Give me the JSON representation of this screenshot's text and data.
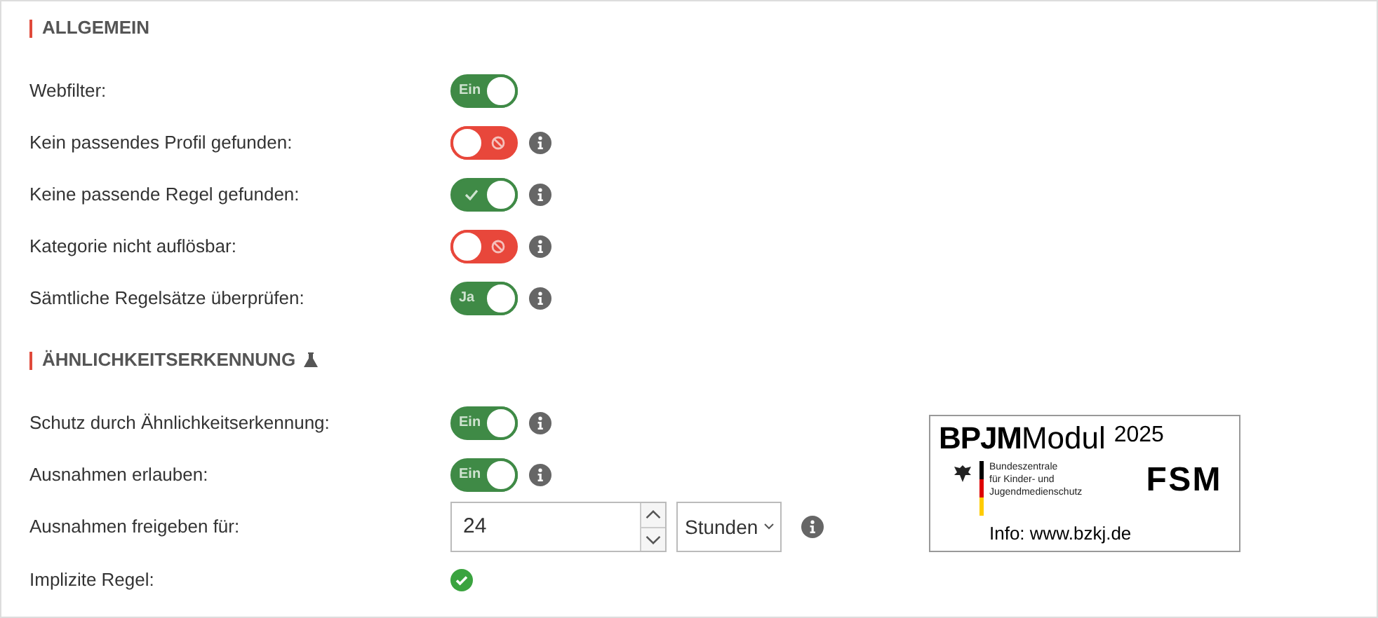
{
  "sections": [
    {
      "title": "ALLGEMEIN",
      "flask": false,
      "rows": [
        {
          "kind": "toggle",
          "label": "Webfilter:",
          "on": true,
          "text": "Ein",
          "info": false
        },
        {
          "kind": "toggle",
          "label": "Kein passendes Profil gefunden:",
          "on": false,
          "info": true
        },
        {
          "kind": "toggle",
          "label": "Keine passende Regel gefunden:",
          "on": true,
          "info": true
        },
        {
          "kind": "toggle",
          "label": "Kategorie nicht auflösbar:",
          "on": false,
          "info": true
        },
        {
          "kind": "toggle",
          "label": "Sämtliche Regelsätze überprüfen:",
          "on": true,
          "text": "Ja",
          "info": true
        }
      ]
    },
    {
      "title": "ÄHNLICHKEITSERKENNUNG",
      "flask": true,
      "rows": [
        {
          "kind": "toggle",
          "label": "Schutz durch Ähnlichkeitserkennung:",
          "on": true,
          "text": "Ein",
          "info": true
        },
        {
          "kind": "toggle",
          "label": "Ausnahmen erlauben:",
          "on": true,
          "text": "Ein",
          "info": true
        },
        {
          "kind": "number",
          "label": "Ausnahmen freigeben für:",
          "value": "24",
          "unit": "Stunden",
          "info": true
        },
        {
          "kind": "check",
          "label": "Implizite Regel:",
          "checked": true
        }
      ]
    }
  ],
  "logo": {
    "brand_bold": "BPJM",
    "brand_light": "Modul",
    "year": "2025",
    "agency_lines": [
      "Bundeszentrale",
      "für Kinder- und",
      "Jugendmedienschutz"
    ],
    "partner": "FSM",
    "info": "Info: www.bzkj.de"
  }
}
